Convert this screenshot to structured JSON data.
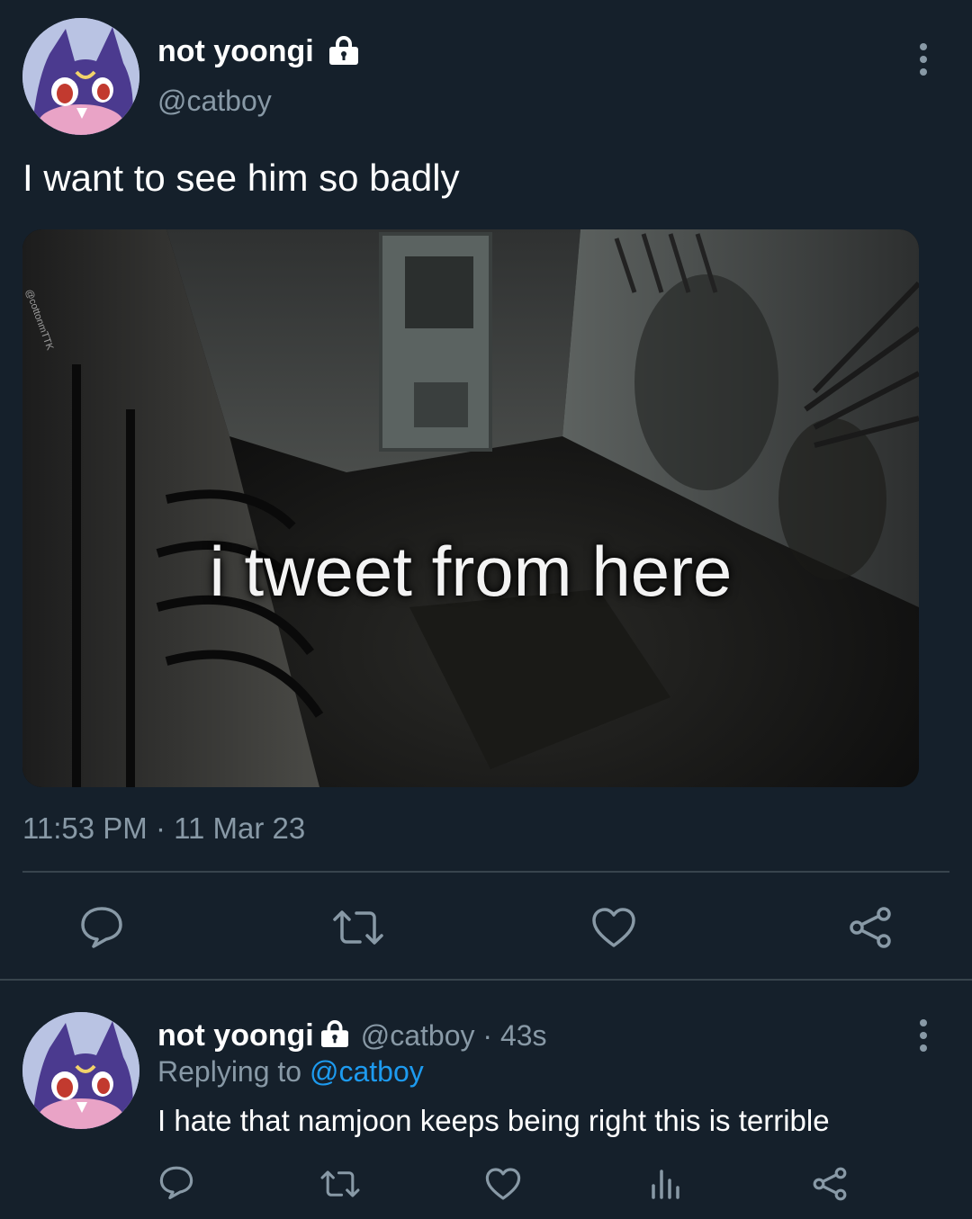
{
  "tweet": {
    "author_name": "not yoongi",
    "author_handle": "@catboy",
    "text": "I want to see him so badly",
    "media": {
      "caption": "i tweet from here",
      "watermark": "@cottonmTTK"
    },
    "timestamp": "11:53 PM · 11 Mar 23"
  },
  "reply": {
    "author_name": "not yoongi",
    "meta": "@catboy · 43s",
    "replying_prefix": "Replying to ",
    "replying_handle": "@catboy",
    "text": "I hate that namjoon keeps being right this is terrible"
  },
  "icons": {
    "reply": "speech-bubble-icon",
    "retweet": "retweet-icon",
    "like": "heart-icon",
    "share": "share-icon",
    "analytics": "bar-chart-icon",
    "lock": "lock-icon",
    "more": "more-vertical-icon"
  },
  "colors": {
    "background": "#15202b",
    "secondary_text": "#8899a6",
    "link": "#1d9bf0",
    "divider": "#38444d"
  }
}
